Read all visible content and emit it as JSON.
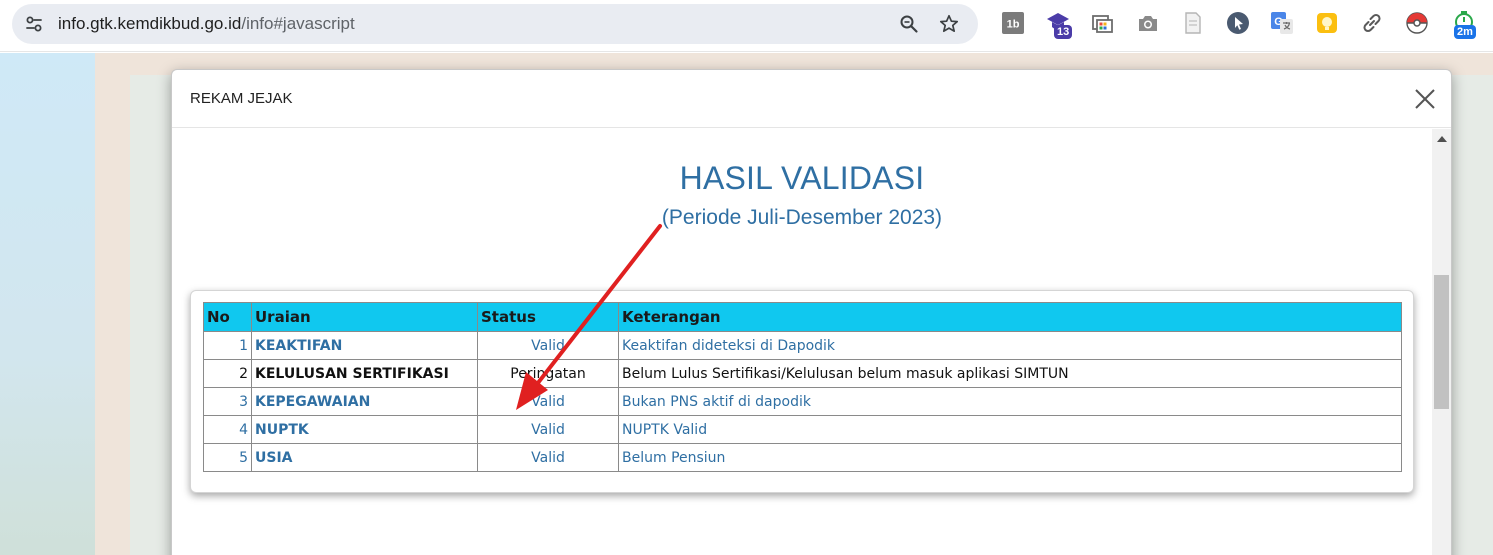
{
  "browser": {
    "url_host": "info.gtk.kemdikbud.go.id",
    "url_path": "/info#javascript",
    "extensions": [
      {
        "name": "1b-extension-icon",
        "label": "1b"
      },
      {
        "name": "graduation-cap-extension-icon",
        "badge": "13",
        "badge_color": "#4b3ca8"
      },
      {
        "name": "screen-capture-extension-icon"
      },
      {
        "name": "camera-extension-icon"
      },
      {
        "name": "document-extension-icon"
      },
      {
        "name": "cursor-extension-icon"
      },
      {
        "name": "google-translate-extension-icon"
      },
      {
        "name": "yellow-note-extension-icon"
      },
      {
        "name": "link-extension-icon"
      },
      {
        "name": "pokeball-extension-icon"
      },
      {
        "name": "timer-extension-icon",
        "badge": "2m",
        "badge_color": "#1a73e8"
      }
    ]
  },
  "modal": {
    "title": "REKAM JEJAK",
    "heading": "HASIL VALIDASI",
    "subheading": "(Periode Juli-Desember 2023)",
    "accent_color": "#2f6fa3",
    "header_color": "#10c8ef",
    "table": {
      "columns": [
        "No",
        "Uraian",
        "Status",
        "Keterangan"
      ],
      "rows": [
        {
          "no": "1",
          "uraian": "KEAKTIFAN",
          "status": "Valid",
          "keterangan": "Keaktifan dideteksi di Dapodik",
          "kind": "valid"
        },
        {
          "no": "2",
          "uraian": "KELULUSAN SERTIFIKASI",
          "status": "Peringatan",
          "keterangan": "Belum Lulus Sertifikasi/Kelulusan belum masuk aplikasi SIMTUN",
          "kind": "warn"
        },
        {
          "no": "3",
          "uraian": "KEPEGAWAIAN",
          "status": "Valid",
          "keterangan": "Bukan PNS aktif di dapodik",
          "kind": "valid"
        },
        {
          "no": "4",
          "uraian": "NUPTK",
          "status": "Valid",
          "keterangan": "NUPTK Valid",
          "kind": "valid"
        },
        {
          "no": "5",
          "uraian": "USIA",
          "status": "Valid",
          "keterangan": "Belum Pensiun",
          "kind": "valid"
        }
      ]
    },
    "annotation_color": "#e02020"
  }
}
